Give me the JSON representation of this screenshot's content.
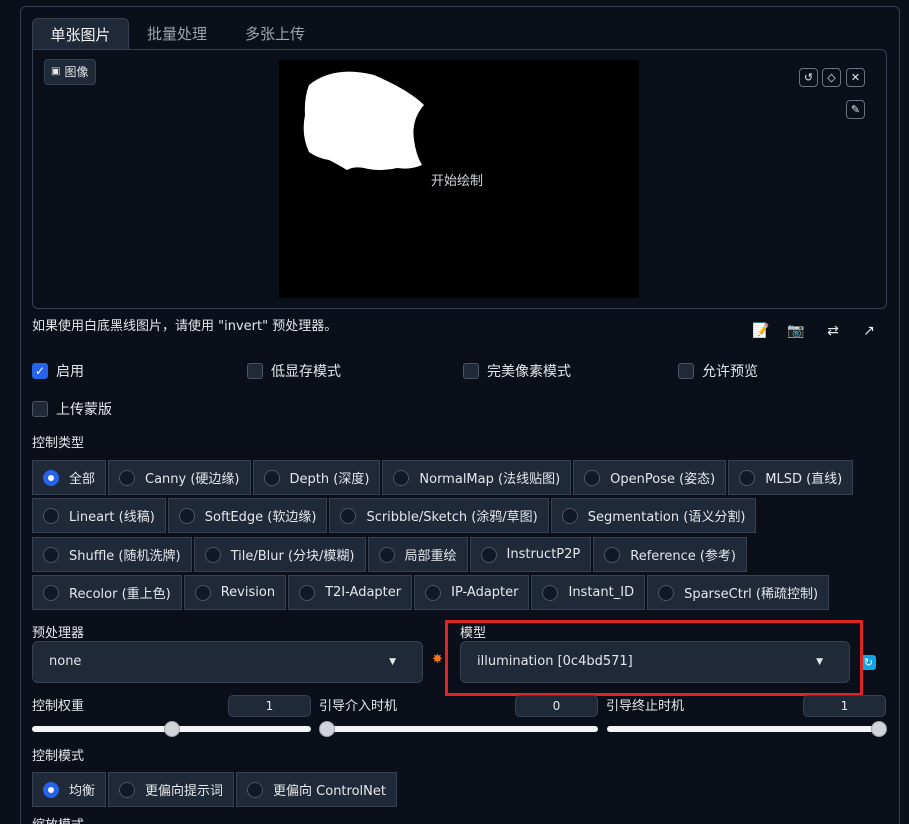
{
  "tabs": [
    "单张图片",
    "批量处理",
    "多张上传"
  ],
  "image_panel": {
    "label": "图像",
    "canvas_hint": "开始绘制"
  },
  "tools": [
    "undo-icon",
    "eraser-icon",
    "close-icon",
    "pen-icon"
  ],
  "note": "如果使用白底黑线图片，请使用 \"invert\" 预处理器。",
  "aux_icons": [
    "edit-icon",
    "camera-icon",
    "swap-icon",
    "send-icon"
  ],
  "checkboxes": {
    "enable": {
      "label": "启用",
      "checked": true
    },
    "low_vram": {
      "label": "低显存模式",
      "checked": false
    },
    "pixel_perfect": {
      "label": "完美像素模式",
      "checked": false
    },
    "allow_preview": {
      "label": "允许预览",
      "checked": false
    },
    "upload_mask": {
      "label": "上传蒙版",
      "checked": false
    }
  },
  "control_type": {
    "label": "控制类型",
    "rows": [
      [
        "全部",
        "Canny (硬边缘)",
        "Depth (深度)",
        "NormalMap (法线贴图)",
        "OpenPose (姿态)",
        "MLSD (直线)"
      ],
      [
        "Lineart (线稿)",
        "SoftEdge (软边缘)",
        "Scribble/Sketch (涂鸦/草图)",
        "Segmentation (语义分割)"
      ],
      [
        "Shuffle (随机洗牌)",
        "Tile/Blur (分块/模糊)",
        "局部重绘",
        "InstructP2P",
        "Reference (参考)"
      ],
      [
        "Recolor (重上色)",
        "Revision",
        "T2I-Adapter",
        "IP-Adapter",
        "Instant_ID",
        "SparseCtrl (稀疏控制)"
      ]
    ],
    "selected": "全部"
  },
  "preprocessor": {
    "label": "预处理器",
    "value": "none"
  },
  "model": {
    "label": "模型",
    "value": "illumination [0c4bd571]"
  },
  "sliders": {
    "weight": {
      "label": "控制权重",
      "value": "1",
      "fraction": 0.5
    },
    "start": {
      "label": "引导介入时机",
      "value": "0",
      "fraction": 0.0
    },
    "end": {
      "label": "引导终止时机",
      "value": "1",
      "fraction": 1.0
    }
  },
  "control_mode": {
    "label": "控制模式",
    "options": [
      "均衡",
      "更偏向提示词",
      "更偏向 ControlNet"
    ],
    "selected": "均衡"
  },
  "resize_mode": {
    "label": "缩放模式"
  },
  "colors": {
    "accent": "#2563eb",
    "highlight": "#e02424",
    "background": "#0b0f19"
  }
}
